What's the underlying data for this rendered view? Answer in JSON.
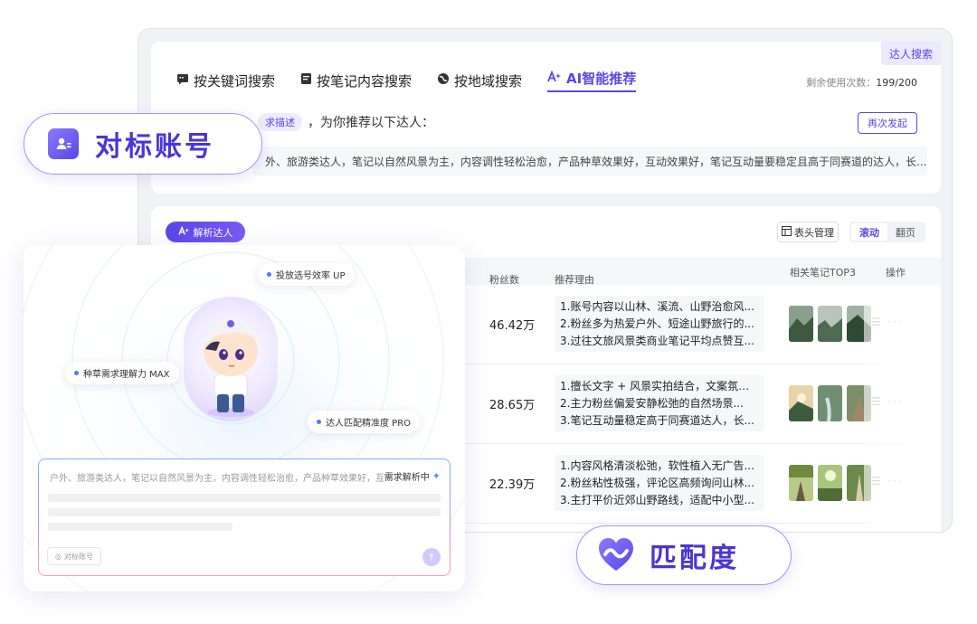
{
  "window": {
    "corner_tag": "达人搜索",
    "tabs": [
      {
        "label": "按关键词搜索",
        "icon": "message-square-icon",
        "active": false
      },
      {
        "label": "按笔记内容搜索",
        "icon": "document-icon",
        "active": false
      },
      {
        "label": "按地域搜索",
        "icon": "globe-icon",
        "active": false
      },
      {
        "label": "AI智能推荐",
        "icon": "ai-sparkle-icon",
        "active": true
      }
    ],
    "remaining_label": "剩余使用次数：",
    "remaining_value": "199/200",
    "prompt_pill": "求描述",
    "prompt_text": "，为你推荐以下达人：",
    "retry_label": "再次发起",
    "description": "外、旅游类达人，笔记以自然风景为主，内容调性轻松治愈，产品种草效果好，互动效果好，笔记互动量要稳定且高于同赛道的达人，长..."
  },
  "table": {
    "parse_label": "解析达人",
    "header_manage_label": "表头管理",
    "mode_scroll": "滚动",
    "mode_page": "翻页",
    "columns": {
      "fans": "粉丝数",
      "reason": "推荐理由",
      "notes": "相关笔记TOP3",
      "ops": "操作"
    },
    "rows": [
      {
        "fans": "46.42万",
        "reasons": [
          "1.账号内容以山林、溪流、山野治愈风...",
          "2.粉丝多为热爱户外、短途山野旅行的...",
          "3.过往文旅风景类商业笔记平均点赞互..."
        ]
      },
      {
        "fans": "28.65万",
        "reasons": [
          "1.擅长文字 + 风景实拍结合，文案氛围...",
          "2.主力粉丝偏爱安静松弛的自然场景...",
          "3.笔记互动量稳定高于同赛道达人，长..."
        ]
      },
      {
        "fans": "22.39万",
        "reasons": [
          "1.内容风格清淡松弛，软性植入无广告...",
          "2.粉丝粘性极强，评论区高频询问山林...",
          "3.主打平价近郊山野路线，适配中小型..."
        ]
      }
    ]
  },
  "ai_panel": {
    "chip_efficiency": "投放选号效率 UP",
    "chip_understanding": "种草需求理解力 MAX",
    "chip_accuracy": "达人匹配精准度 PRO",
    "input_text": "户外、旅游类达人，笔记以自然风景为主，内容调性轻松治愈，产品种草效果好，互...",
    "parsing_label": "需求解析中",
    "bench_chip_label": "对标账号"
  },
  "badges": {
    "bench": "对标账号",
    "match": "匹配度"
  },
  "colors": {
    "accent": "#5b47e8",
    "accent_dark": "#4a35d6",
    "card_bg": "#ffffff",
    "window_bg": "#f1f2f5"
  }
}
